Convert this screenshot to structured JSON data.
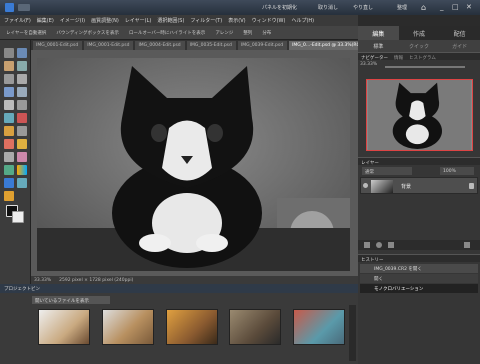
{
  "topbar": {
    "reset_panels": "パネルを初期化",
    "undo": "取り消し",
    "redo": "やり直し",
    "organizer": "整理"
  },
  "menu": [
    "ファイル(F)",
    "編集(E)",
    "イメージ(I)",
    "画質調整(N)",
    "レイヤー(L)",
    "選択範囲(S)",
    "フィルター(T)",
    "表示(V)",
    "ウィンドウ(W)",
    "ヘルプ(H)"
  ],
  "options": {
    "auto_select": "レイヤーを自動選択",
    "bbox": "バウンディングボックスを表示",
    "rollover": "ロールオーバー時にハイライトを表示",
    "arrange": "アレンジ",
    "align": "整列",
    "distribute": "分布"
  },
  "doc_tabs": [
    "IMG_0001-Edit.psd",
    "IMG_0001-Edit.psd",
    "IMG_0004-Edit.psd",
    "IMG_0035-Edit.psd",
    "IMG_0039-Edit.psd",
    "IMG_0...-Edit.psd @ 33.3%(RGB/8*)"
  ],
  "status": {
    "zoom": "33.33%",
    "doc": "2592 pixel × 1728 pixel (240ppi)"
  },
  "bin": {
    "title": "プロジェクトビン",
    "dropdown": "開いているファイルを表示"
  },
  "right": {
    "tabs": [
      "編集",
      "作成",
      "配信"
    ],
    "subtabs": [
      "標準",
      "クイック",
      "ガイド"
    ],
    "navigator": {
      "title": "ナビゲーター",
      "tab2": "情報",
      "tab3": "ヒストグラム",
      "zoom": "33.33%"
    },
    "layers": {
      "title": "レイヤー",
      "blend": "通常",
      "opacity": "100%",
      "layer_name": "背景"
    },
    "history": {
      "title": "ヒストリー",
      "items": [
        "IMG_0039.CR2 を開く",
        "開く",
        "モノクロバリエーション"
      ]
    }
  }
}
